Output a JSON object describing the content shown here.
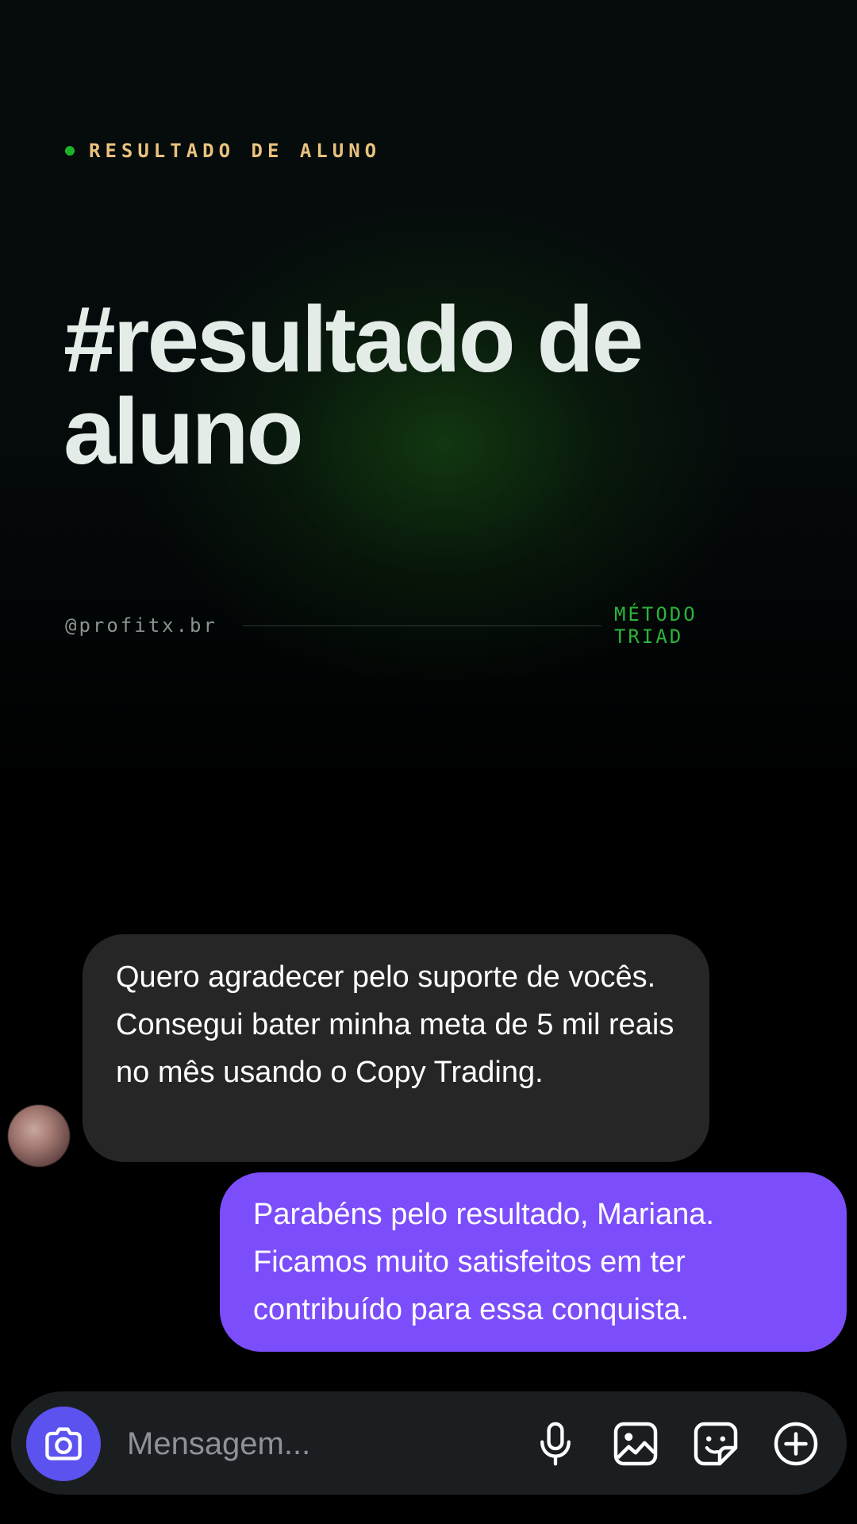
{
  "header": {
    "kicker": "RESULTADO DE ALUNO",
    "headline_line1": "#resultado de",
    "headline_line2": "aluno",
    "handle": "@profitx.br",
    "method": "MÉTODO TRIAD"
  },
  "chat": {
    "incoming_message": "Quero agradecer pelo suporte de vocês. Consegui bater minha meta de 5 mil reais no mês usando o Copy Trading.",
    "outgoing_message": "Parabéns pelo resultado, Mariana. Ficamos muito satisfeitos em ter contribuído para essa conquista."
  },
  "composer": {
    "placeholder": "Mensagem...",
    "icons": [
      "camera-icon",
      "microphone-icon",
      "gallery-icon",
      "sticker-icon",
      "add-icon"
    ]
  },
  "colors": {
    "accent_green": "#1db328",
    "kicker_gold": "#e8c27e",
    "outgoing_bubble": "#7c4dfb",
    "incoming_bubble": "#262626",
    "camera_button": "#5b52f0"
  }
}
